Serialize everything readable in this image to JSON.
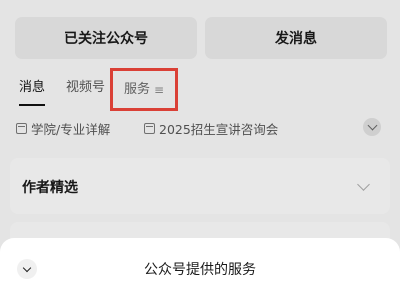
{
  "header": {
    "followed_label": "已关注公众号",
    "message_label": "发消息"
  },
  "tabs": [
    {
      "label": "消息",
      "active": true
    },
    {
      "label": "视频号",
      "active": false
    },
    {
      "label": "服务",
      "active": false,
      "highlighted": true
    }
  ],
  "chips": [
    {
      "label": "学院/专业详解"
    },
    {
      "label": "2025招生宣讲咨询会"
    }
  ],
  "card": {
    "title": "作者精选"
  },
  "sheet": {
    "title": "公众号提供的服务"
  },
  "colors": {
    "highlight_border": "#e8443a",
    "sheet_bg": "#ffffff",
    "page_bg": "#f3f3f3"
  }
}
